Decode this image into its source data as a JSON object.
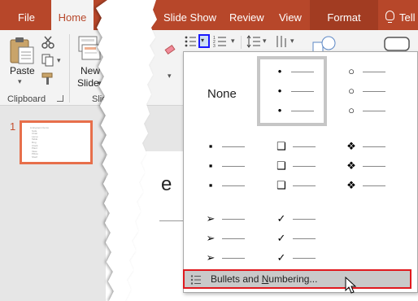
{
  "tabs": {
    "file": "File",
    "home": "Home",
    "slide_show": "Slide Show",
    "review": "Review",
    "view": "View",
    "format": "Format",
    "tell": "Tell"
  },
  "clipboard": {
    "paste": "Paste",
    "group": "Clipboard"
  },
  "slides": {
    "new_slide_line1": "New",
    "new_slide_line2": "Slide",
    "group": "Slide"
  },
  "thumbnail": {
    "number": "1",
    "mini_lines": [
      "Livingroom Items",
      "Sofa",
      "Chair",
      "Lamp",
      "Table",
      "Rug",
      "Clock",
      "Plant",
      "Vase",
      "Pillow",
      "Shelf"
    ]
  },
  "slide": {
    "partial_title": "e"
  },
  "bullets_menu": {
    "none_label": "None",
    "styles": [
      {
        "name": "none",
        "symbol": ""
      },
      {
        "name": "filled-round",
        "symbol": "•"
      },
      {
        "name": "hollow-round",
        "symbol": "○"
      },
      {
        "name": "filled-square",
        "symbol": "▪"
      },
      {
        "name": "hollow-square",
        "symbol": "❑"
      },
      {
        "name": "star",
        "symbol": "❖"
      },
      {
        "name": "arrow",
        "symbol": "➢"
      },
      {
        "name": "checkmark",
        "symbol": "✓"
      }
    ],
    "selected": "filled-round",
    "footer_label_pre": "Bullets and ",
    "footer_label_ul": "N",
    "footer_label_post": "umbering..."
  },
  "colors": {
    "accent": "#b7472a",
    "highlight_border": "#e0191e",
    "thumbnail_border": "#e76f4b"
  }
}
